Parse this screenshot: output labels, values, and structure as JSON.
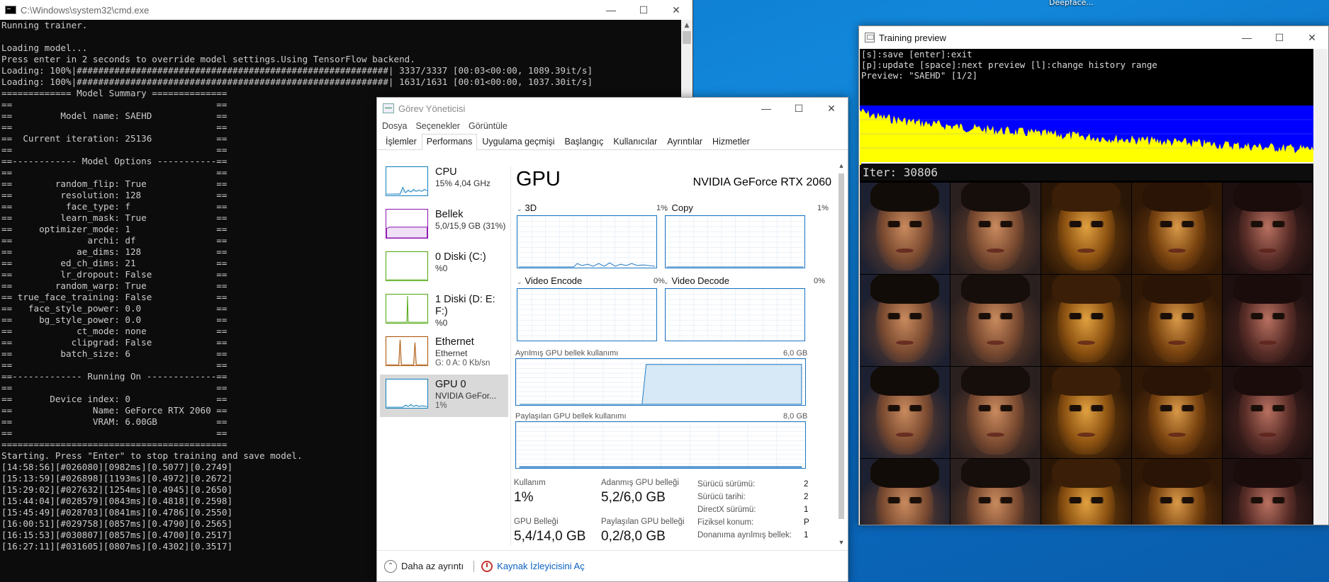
{
  "desktop": {
    "label": "Deepface..."
  },
  "cmd": {
    "title": "C:\\Windows\\system32\\cmd.exe",
    "lines": [
      "Running trainer.",
      "",
      "Loading model...",
      "Press enter in 2 seconds to override model settings.Using TensorFlow backend.",
      "Loading: 100%|##########################################################| 3337/3337 [00:03<00:00, 1089.39it/s]",
      "Loading: 100%|##########################################################| 1631/1631 [00:01<00:00, 1037.30it/s]",
      "============= Model Summary ==============",
      "==                                      ==",
      "==         Model name: SAEHD            ==",
      "==                                      ==",
      "==  Current iteration: 25136            ==",
      "==                                      ==",
      "==------------ Model Options -----------==",
      "==                                      ==",
      "==        random_flip: True             ==",
      "==         resolution: 128              ==",
      "==          face_type: f                ==",
      "==         learn_mask: True             ==",
      "==     optimizer_mode: 1                ==",
      "==              archi: df               ==",
      "==            ae_dims: 128              ==",
      "==         ed_ch_dims: 21               ==",
      "==         lr_dropout: False            ==",
      "==        random_warp: True             ==",
      "== true_face_training: False            ==",
      "==   face_style_power: 0.0              ==",
      "==     bg_style_power: 0.0              ==",
      "==            ct_mode: none             ==",
      "==           clipgrad: False            ==",
      "==         batch_size: 6                ==",
      "==                                      ==",
      "==------------- Running On -------------==",
      "==                                      ==",
      "==       Device index: 0                ==",
      "==               Name: GeForce RTX 2060 ==",
      "==               VRAM: 6.00GB           ==",
      "==                                      ==",
      "==========================================",
      "Starting. Press \"Enter\" to stop training and save model.",
      "[14:58:56][#026080][0982ms][0.5077][0.2749]",
      "[15:13:59][#026898][1193ms][0.4972][0.2672]",
      "[15:29:02][#027632][1254ms][0.4945][0.2650]",
      "[15:44:04][#028579][0843ms][0.4818][0.2598]",
      "[15:45:49][#028703][0841ms][0.4786][0.2550]",
      "[16:00:51][#029758][0857ms][0.4790][0.2565]",
      "[16:15:53][#030807][0857ms][0.4700][0.2517]",
      "[16:27:11][#031605][0807ms][0.4302][0.3517]"
    ]
  },
  "taskmgr": {
    "title": "Görev Yöneticisi",
    "menu": [
      "Dosya",
      "Seçenekler",
      "Görüntüle"
    ],
    "tabs": [
      "İşlemler",
      "Performans",
      "Uygulama geçmişi",
      "Başlangıç",
      "Kullanıcılar",
      "Ayrıntılar",
      "Hizmetler"
    ],
    "active_tab": "Performans",
    "sidebar": [
      {
        "title": "CPU",
        "sub": "15% 4,04 GHz",
        "sub2": "",
        "color": "#117dbb"
      },
      {
        "title": "Bellek",
        "sub": "5,0/15,9 GB (31%)",
        "sub2": "",
        "color": "#8b12ae"
      },
      {
        "title": "0 Diski (C:)",
        "sub": "%0",
        "sub2": "",
        "color": "#4da60c"
      },
      {
        "title": "1 Diski (D: E: F:)",
        "sub": "%0",
        "sub2": "",
        "color": "#4da60c"
      },
      {
        "title": "Ethernet",
        "sub": "Ethernet",
        "sub2": "G: 0 A: 0 Kb/sn",
        "color": "#a74f01"
      },
      {
        "title": "GPU 0",
        "sub": "NVIDIA GeFor...",
        "sub2": "1%",
        "color": "#117dbb"
      }
    ],
    "gpu": {
      "title": "GPU",
      "model": "NVIDIA GeForce RTX 2060",
      "engines": [
        {
          "name": "3D",
          "pct": "1%"
        },
        {
          "name": "Copy",
          "pct": "1%"
        },
        {
          "name": "Video Encode",
          "pct": "0%"
        },
        {
          "name": "Video Decode",
          "pct": "0%"
        }
      ],
      "dedicated_label": "Ayrılmış GPU bellek kullanımı",
      "dedicated_max": "6,0 GB",
      "shared_label": "Paylaşılan GPU bellek kullanımı",
      "shared_max": "8,0 GB",
      "stats": {
        "usage_label": "Kullanım",
        "usage": "1%",
        "dedicated_label": "Adanmış GPU belleği",
        "dedicated": "5,2/6,0 GB",
        "gpu_mem_label": "GPU Belleği",
        "gpu_mem": "5,4/14,0 GB",
        "shared_label": "Paylaşılan GPU belleği",
        "shared": "0,2/8,0 GB"
      },
      "info": [
        {
          "k": "Sürücü sürümü:",
          "v": "2"
        },
        {
          "k": "Sürücü tarihi:",
          "v": "2"
        },
        {
          "k": "DirectX sürümü:",
          "v": "1"
        },
        {
          "k": "Fiziksel konum:",
          "v": "P"
        },
        {
          "k": "Donanıma ayrılmış bellek:",
          "v": "1"
        }
      ]
    },
    "footer": {
      "fewer": "Daha az ayrıntı",
      "resmon": "Kaynak İzleyicisini Aç"
    }
  },
  "preview": {
    "title": "Training preview",
    "lines": [
      "[s]:save [enter]:exit",
      "[p]:update [space]:next preview [l]:change history range",
      "Preview: \"SAEHD\" [1/2]"
    ],
    "iter": "Iter: 30806"
  }
}
